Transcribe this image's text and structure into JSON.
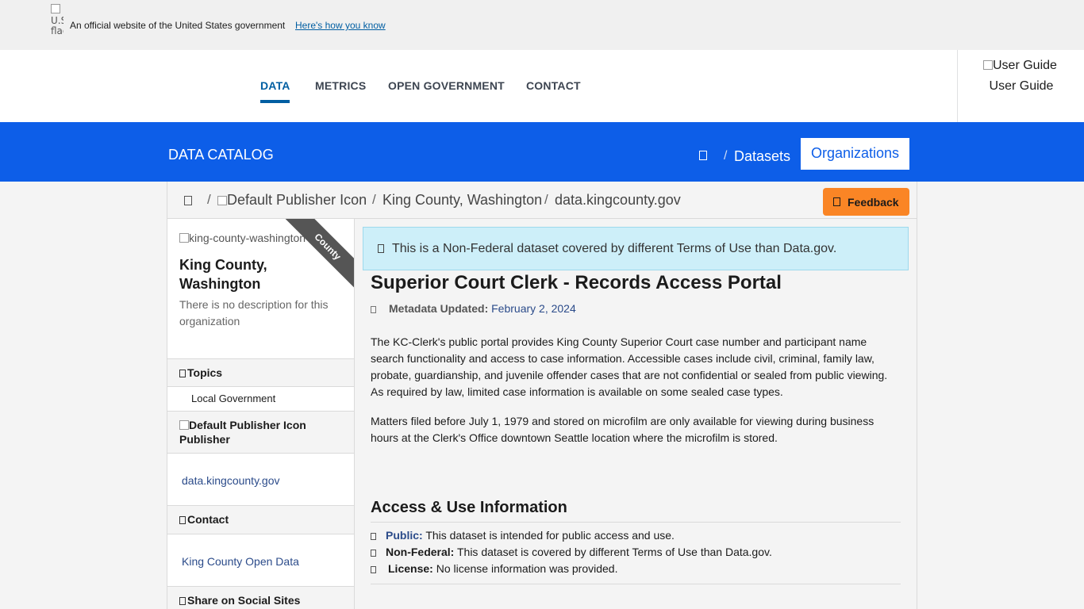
{
  "gov_banner": {
    "flag_alt": "U.S. flag",
    "text": "An official website of the United States government",
    "link": "Here's how you know"
  },
  "nav": {
    "items": [
      "DATA",
      "METRICS",
      "OPEN GOVERNMENT",
      "CONTACT"
    ],
    "active": "DATA",
    "user_guide_alt": "User Guide",
    "user_guide_label": "User Guide"
  },
  "catalog": {
    "title": "DATA CATALOG",
    "separator": "/",
    "datasets": "Datasets",
    "organizations": "Organizations",
    "accent": "#0d5ee8"
  },
  "breadcrumb": {
    "separator": "/",
    "publisher_icon_alt": "Default Publisher Icon",
    "org": "King County, Washington",
    "publisher": "data.kingcounty.gov"
  },
  "feedback": {
    "label": "Feedback",
    "color": "#fa8525"
  },
  "sidebar": {
    "org_image_alt": "king-county-washington",
    "ribbon": "County",
    "org_name": "King County, Washington",
    "org_description": "There is no description for this organization",
    "topics_heading": "Topics",
    "topics": [
      "Local Government"
    ],
    "publisher_icon_alt": "Default Publisher Icon",
    "publisher_heading": "Publisher",
    "publisher_link": "data.kingcounty.gov",
    "contact_heading": "Contact",
    "contact_link": "King County Open Data",
    "share_heading": "Share on Social Sites"
  },
  "dataset": {
    "notice": "This is a Non-Federal dataset covered by different Terms of Use than Data.gov.",
    "title": "Superior Court Clerk - Records Access Portal",
    "metadata_label": "Metadata Updated:",
    "metadata_value": "February 2, 2024",
    "paragraphs": [
      "The KC-Clerk's public portal provides King County Superior Court case number and participant name search functionality and access to case information. Accessible cases include civil, criminal, family law, probate, guardianship, and juvenile offender cases that are not confidential or sealed from public viewing. As required by law, limited case information is available on some sealed case types.",
      "Matters filed before July 1, 1979 and stored on microfilm are only available for viewing during business hours at the Clerk's Office downtown Seattle location where the microfilm is stored."
    ],
    "access_heading": "Access & Use Information",
    "access": [
      {
        "key": "Public:",
        "text": "This dataset is intended for public access and use."
      },
      {
        "key": "Non-Federal:",
        "text": "This dataset is covered by different Terms of Use than Data.gov."
      },
      {
        "key": "License:",
        "text": "No license information was provided."
      }
    ]
  }
}
